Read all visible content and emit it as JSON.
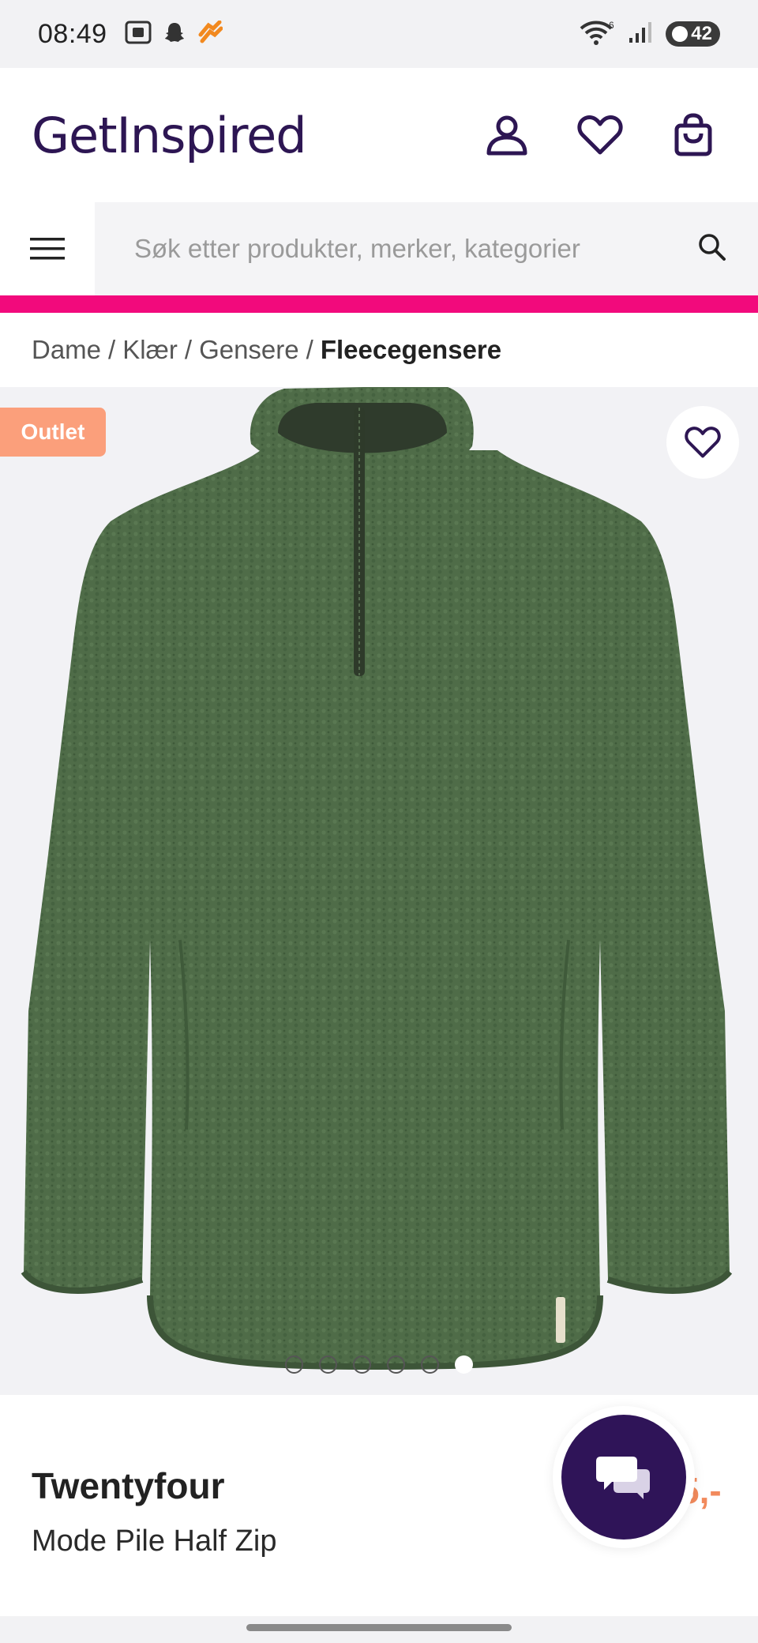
{
  "status_bar": {
    "time": "08:49",
    "battery": "42",
    "wifi_badge": "6",
    "left_icons": [
      "screenshot-icon",
      "snapchat-icon",
      "streak-icon"
    ],
    "right_icons": [
      "wifi-icon",
      "signal-icon",
      "battery-icon"
    ]
  },
  "header": {
    "logo": "GetInspired",
    "icons": [
      "account-icon",
      "heart-icon",
      "shopping-bag-icon"
    ]
  },
  "search": {
    "placeholder": "Søk etter produkter, merker, kategorier",
    "icons": [
      "menu-icon",
      "search-icon"
    ]
  },
  "breadcrumb": {
    "items": [
      "Dame",
      "Klær",
      "Gensere"
    ],
    "current": "Fleecegensere",
    "separator": "/"
  },
  "gallery": {
    "badge": "Outlet",
    "image_count": 6,
    "active_index": 6,
    "product_color": "#4e6b46"
  },
  "product": {
    "brand": "Twentyfour",
    "name": "Mode Pile Half Zip",
    "price_visible": "5,-"
  },
  "colors": {
    "brand_purple": "#2d1653",
    "accent_pink": "#f20a7c",
    "outlet_orange": "#fb9f7b",
    "price_orange": "#f28a5c"
  }
}
